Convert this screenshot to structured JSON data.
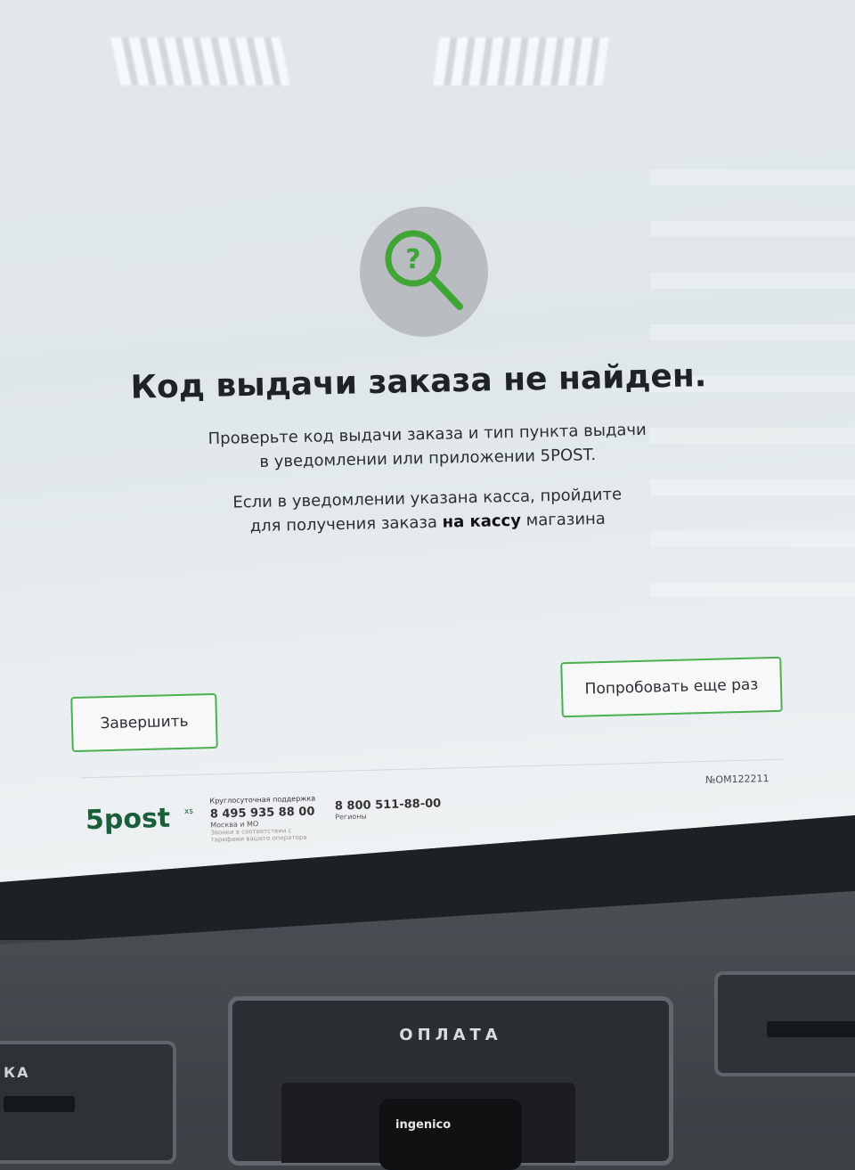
{
  "screen": {
    "title": "Код выдачи заказа не найден.",
    "message_line1": "Проверьте код выдачи заказа и тип пункта выдачи",
    "message_line2": "в уведомлении или приложении 5POST.",
    "hint_line1": "Если в уведомлении указана касса, пройдите",
    "hint_line2_prefix": "для получения заказа ",
    "hint_line2_bold": "на кассу",
    "hint_line2_suffix": " магазина",
    "finish_button": "Завершить",
    "retry_button": "Попробовать еще раз",
    "terminal_id": "№OM122211",
    "icon": "search-question-icon",
    "accent_color": "#4caf50"
  },
  "footer": {
    "logo_text": "5post",
    "logo_suffix": "xs",
    "support_title": "Круглосуточная поддержка",
    "phone_moscow": "8 495 935 88 00",
    "phone_moscow_label": "Москва и МО",
    "phone_note_line1": "Звонки в соответствии с",
    "phone_note_line2": "тарифами вашего оператора",
    "phone_regions": "8 800 511-88-00",
    "phone_regions_label": "Регионы"
  },
  "kiosk": {
    "payment_label": "ОПЛАТА",
    "left_slot_label": "КА",
    "card_terminal_brand": "ingenico"
  }
}
